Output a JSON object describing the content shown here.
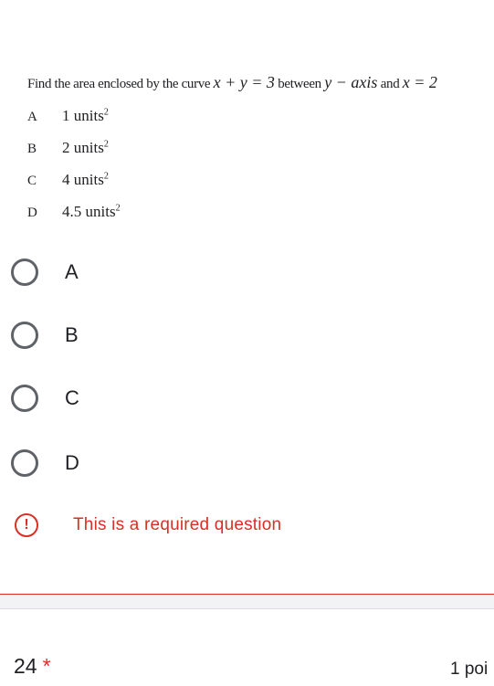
{
  "question": {
    "prefix": "Find the area enclosed by the curve",
    "equation": "x + y = 3",
    "between": "between",
    "yaxis": "y − axis",
    "and": "and",
    "xeq": "x = 2"
  },
  "choices": [
    {
      "letter": "A",
      "text": "1 units",
      "sup": "2"
    },
    {
      "letter": "B",
      "text": "2 units",
      "sup": "2"
    },
    {
      "letter": "C",
      "text": "4 units",
      "sup": "2"
    },
    {
      "letter": "D",
      "text": "4.5 units",
      "sup": "2"
    }
  ],
  "options": [
    {
      "label": "A"
    },
    {
      "label": "B"
    },
    {
      "label": "C"
    },
    {
      "label": "D"
    }
  ],
  "validation": {
    "icon": "!",
    "message": "This is a required question"
  },
  "next_question": {
    "number": "24",
    "asterisk": "*",
    "points": "1 poi"
  },
  "colors": {
    "error": "#d93025",
    "radio_border": "#5f6368",
    "separator": "#f1f3f4"
  },
  "icons": [
    "radio-unchecked-icon",
    "exclamation-icon"
  ]
}
